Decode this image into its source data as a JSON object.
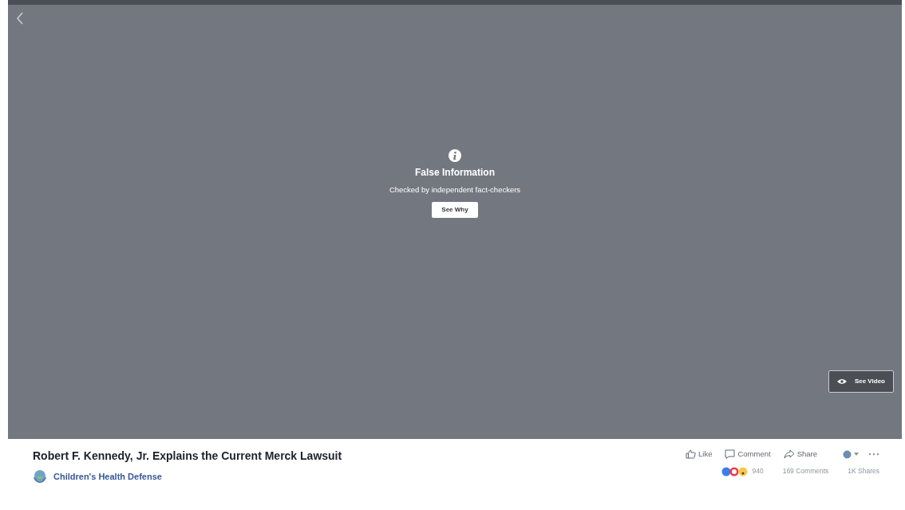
{
  "overlay": {
    "title": "False Information",
    "subtitle": "Checked by independent fact-checkers",
    "button": "See Why"
  },
  "see_video_button": "See Video",
  "post": {
    "title": "Robert F. Kennedy, Jr. Explains the Current Merck Lawsuit",
    "page_name": "Children's Health Defense"
  },
  "actions": [
    {
      "kind": "like",
      "label": "Like"
    },
    {
      "kind": "comment",
      "label": "Comment"
    },
    {
      "kind": "share",
      "label": "Share"
    }
  ],
  "stats": {
    "reactions_count": "940",
    "comments": "169 Comments",
    "shares": "1K Shares"
  }
}
